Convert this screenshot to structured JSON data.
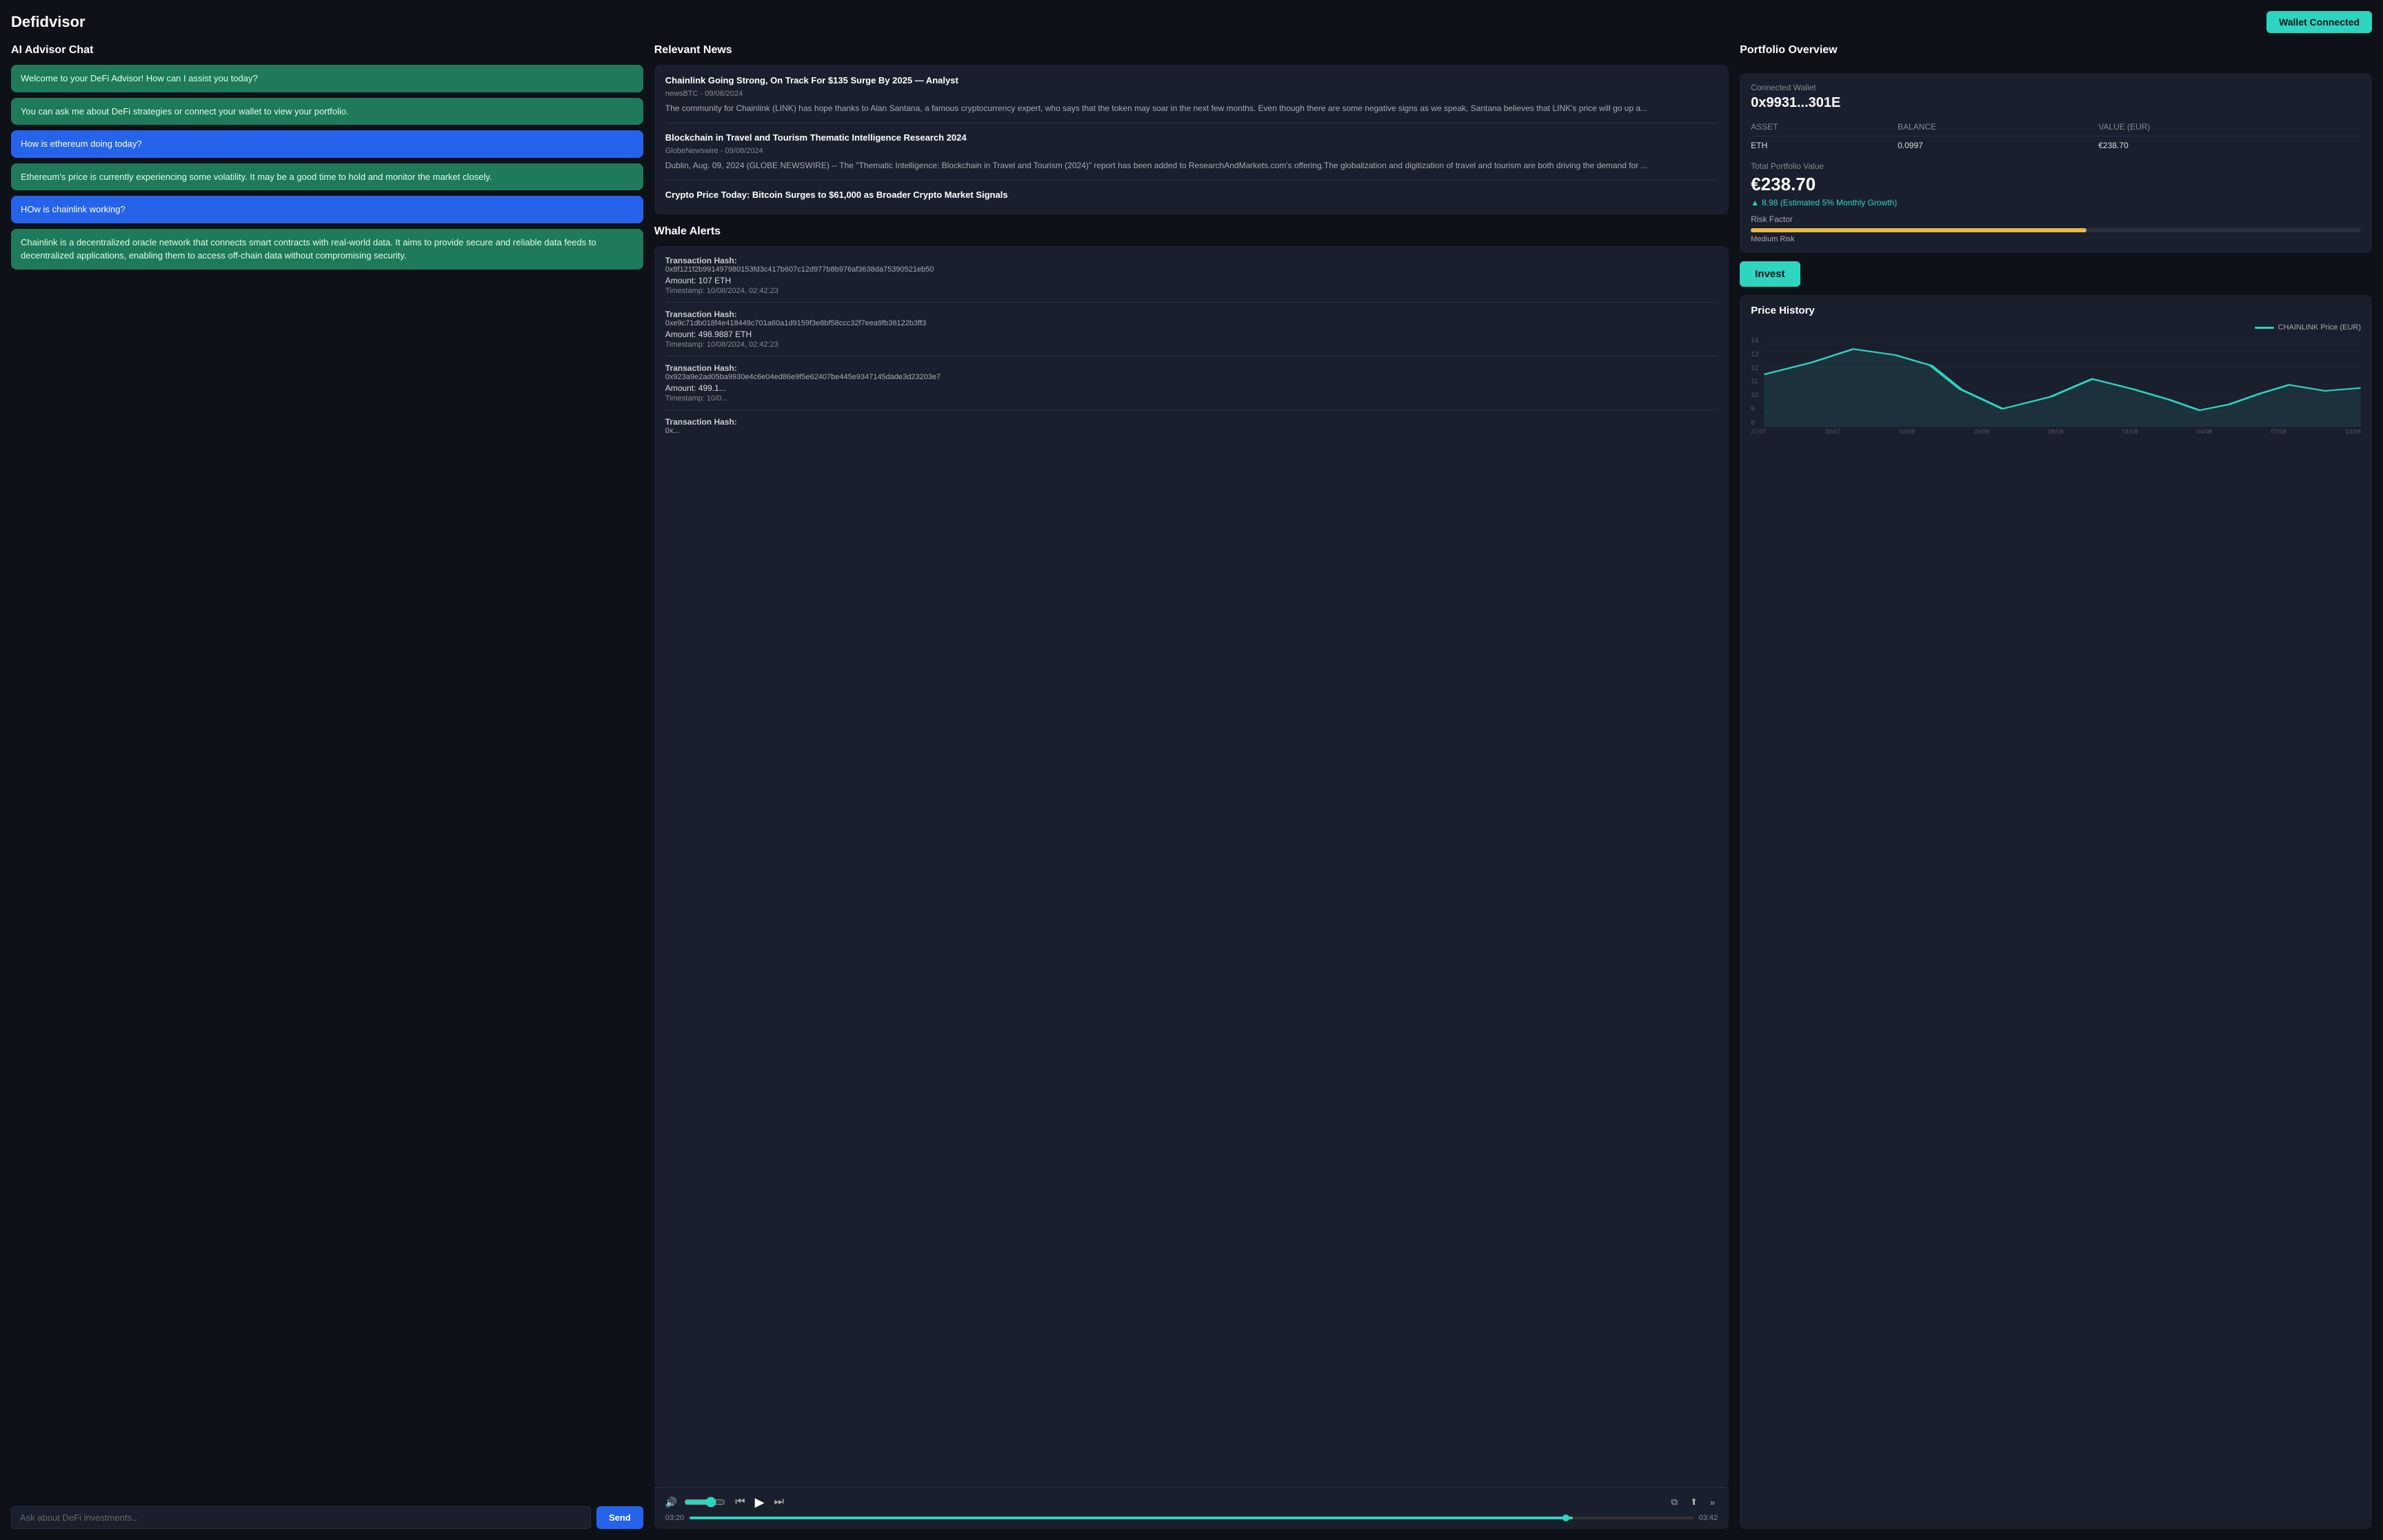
{
  "app": {
    "title": "Defidvisor",
    "wallet_btn": "Wallet Connected"
  },
  "chat": {
    "panel_title": "AI Advisor Chat",
    "input_placeholder": "Ask about DeFi investments...",
    "send_label": "Send",
    "messages": [
      {
        "role": "assistant",
        "text": "Welcome to your DeFi Advisor! How can I assist you today?"
      },
      {
        "role": "assistant",
        "text": "You can ask me about DeFi strategies or connect your wallet to view your portfolio."
      },
      {
        "role": "user",
        "text": "How is ethereum doing today?"
      },
      {
        "role": "assistant",
        "text": "Ethereum's price is currently experiencing some volatility. It may be a good time to hold and monitor the market closely."
      },
      {
        "role": "user",
        "text": "HOw is chainlink working?"
      },
      {
        "role": "assistant",
        "text": "Chainlink is a decentralized oracle network that connects smart contracts with real-world data. It aims to provide secure and reliable data feeds to decentralized applications, enabling them to access off-chain data without compromising security."
      }
    ]
  },
  "news": {
    "panel_title": "Relevant News",
    "items": [
      {
        "headline": "Chainlink Going Strong, On Track For $135 Surge By 2025 — Analyst",
        "source": "newsBTC - 09/08/2024",
        "snippet": "The community for Chainlink (LINK) has hope thanks to Alan Santana, a famous cryptocurrency expert, who says that the token may soar in the next few months. Even though there are some negative signs as we speak, Santana believes that LINK's price will go up a..."
      },
      {
        "headline": "Blockchain in Travel and Tourism Thematic Intelligence Research 2024",
        "source": "GlobeNewswire - 09/08/2024",
        "snippet": "Dublin, Aug. 09, 2024 (GLOBE NEWSWIRE) -- The \"Thematic Intelligence: Blockchain in Travel and Tourism (2024)\" report has been added to ResearchAndMarkets.com's offering.The globalization and digitization of travel and tourism are both driving the demand for ..."
      },
      {
        "headline": "Crypto Price Today: Bitcoin Surges to $61,000 as Broader Crypto Market Signals",
        "source": "",
        "snippet": ""
      }
    ]
  },
  "whale": {
    "panel_title": "Whale Alerts",
    "transactions": [
      {
        "hash_label": "Transaction Hash:",
        "hash": "0x8f121f2b991497980153fd3c417b607c12d977b8b976af3638da75390521eb50",
        "amount": "Amount: 107 ETH",
        "timestamp": "Timestamp: 10/08/2024, 02:42:23"
      },
      {
        "hash_label": "Transaction Hash:",
        "hash": "0xe9c71db018f4e418449c701a60a1d9159f3e8bf58ccc32f7eea9fb36122b3ff3",
        "amount": "Amount: 498.9887 ETH",
        "timestamp": "Timestamp: 10/08/2024, 02:42:23"
      },
      {
        "hash_label": "Transaction Hash:",
        "hash": "0x923a9e2ad05ba9930e4c6e04ed86e9f5e62407be445e9347145dade3d23203e7",
        "amount": "Amount: 499.1...",
        "timestamp": "Timestamp: 10/0..."
      },
      {
        "hash_label": "Transaction Hash:",
        "hash": "0x...",
        "amount": "",
        "timestamp": ""
      }
    ]
  },
  "media": {
    "current_time": "03:20",
    "total_time": "03:42",
    "progress_pct": 88
  },
  "portfolio": {
    "panel_title": "Portfolio Overview",
    "connected_wallet_label": "Connected Wallet",
    "wallet_address": "0x9931...301E",
    "table": {
      "headers": [
        "ASSET",
        "BALANCE",
        "VALUE (EUR)"
      ],
      "rows": [
        {
          "asset": "ETH",
          "balance": "0.0997",
          "value": "€238.70"
        }
      ]
    },
    "total_label": "Total Portfolio Value",
    "total_value": "€238.70",
    "growth_text": "8.98 (Estimated 5% Monthly Growth)",
    "risk_label": "Risk Factor",
    "risk_desc": "Medium Risk",
    "invest_label": "Invest"
  },
  "chart": {
    "title": "Price History",
    "legend": "CHAINLINK Price (EUR)",
    "y_labels": [
      "14",
      "13",
      "12",
      "11",
      "10",
      "9",
      "8"
    ],
    "x_labels": [
      "27/07/2024",
      "30/07/2024",
      "02/08/2024",
      "05/08/2024",
      "08/08/2024",
      "01/08/2024",
      "04/08/2024",
      "07/08/2024",
      "10/08/2024"
    ],
    "points": [
      {
        "x": 0,
        "y": 11.5
      },
      {
        "x": 0.08,
        "y": 12.3
      },
      {
        "x": 0.15,
        "y": 13.2
      },
      {
        "x": 0.22,
        "y": 12.8
      },
      {
        "x": 0.28,
        "y": 12.1
      },
      {
        "x": 0.33,
        "y": 10.5
      },
      {
        "x": 0.4,
        "y": 9.2
      },
      {
        "x": 0.48,
        "y": 10.0
      },
      {
        "x": 0.55,
        "y": 11.2
      },
      {
        "x": 0.62,
        "y": 10.5
      },
      {
        "x": 0.68,
        "y": 9.8
      },
      {
        "x": 0.73,
        "y": 9.1
      },
      {
        "x": 0.78,
        "y": 9.5
      },
      {
        "x": 0.83,
        "y": 10.2
      },
      {
        "x": 0.88,
        "y": 10.8
      },
      {
        "x": 0.94,
        "y": 10.4
      },
      {
        "x": 1.0,
        "y": 10.6
      }
    ]
  }
}
